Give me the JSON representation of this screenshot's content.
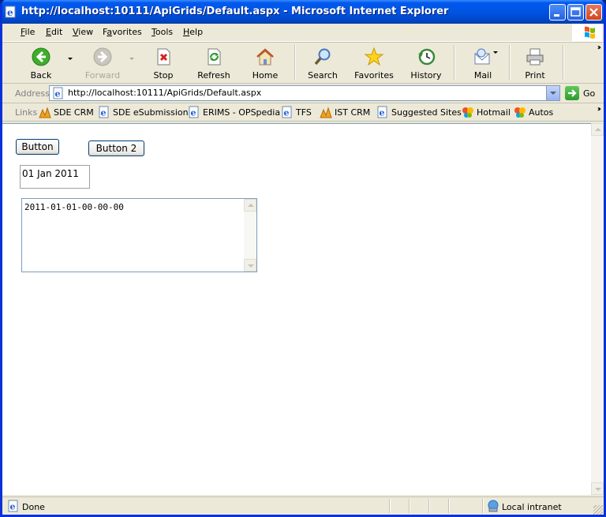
{
  "window": {
    "title": "http://localhost:10111/ApiGrids/Default.aspx - Microsoft Internet Explorer"
  },
  "menu": {
    "items": [
      {
        "label": "File",
        "key": "F",
        "rest": "ile"
      },
      {
        "label": "Edit",
        "key": "E",
        "rest": "dit"
      },
      {
        "label": "View",
        "key": "V",
        "rest": "iew"
      },
      {
        "label": "Favorites",
        "key": "a",
        "pre": "F",
        "rest": "vorites"
      },
      {
        "label": "Tools",
        "key": "T",
        "rest": "ools"
      },
      {
        "label": "Help",
        "key": "H",
        "rest": "elp"
      }
    ]
  },
  "toolbar": {
    "back": "Back",
    "forward": "Forward",
    "stop": "Stop",
    "refresh": "Refresh",
    "home": "Home",
    "search": "Search",
    "favorites": "Favorites",
    "history": "History",
    "mail": "Mail",
    "print": "Print"
  },
  "address": {
    "label": "Address",
    "url": "http://localhost:10111/ApiGrids/Default.aspx",
    "go": "Go"
  },
  "links": {
    "label": "Links",
    "items": [
      "SDE CRM",
      "SDE eSubmission",
      "ERIMS - OPSpedia",
      "TFS",
      "IST CRM",
      "Suggested Sites",
      "Hotmail",
      "Autos"
    ]
  },
  "page": {
    "button1": "Button",
    "button2": "Button 2",
    "date_label": "01 Jan 2011",
    "textarea_value": "2011-01-01-00-00-00"
  },
  "status": {
    "text": "Done",
    "zone": "Local intranet"
  },
  "colors": {
    "titlebar": "#0054e3",
    "chrome": "#ece9d8",
    "border": "#7f9db9"
  }
}
